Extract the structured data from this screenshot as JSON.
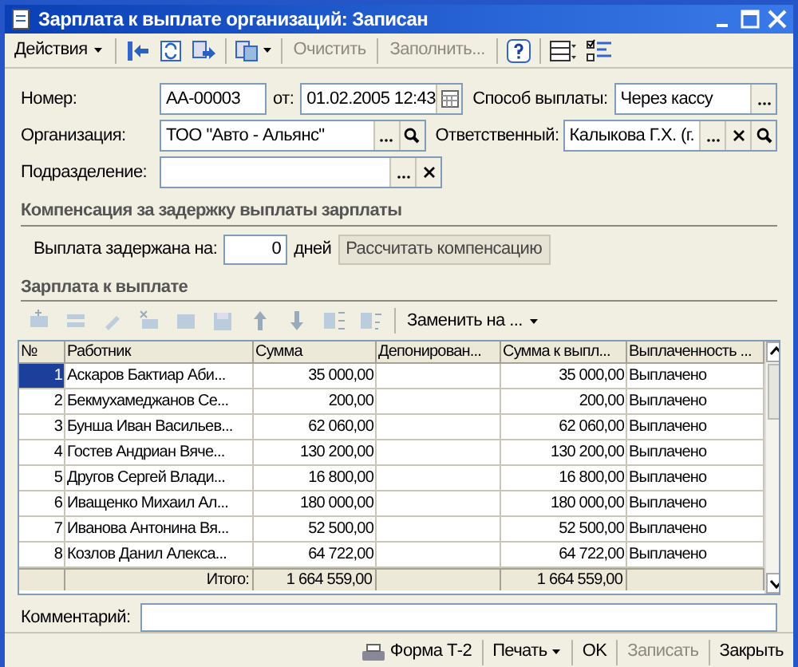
{
  "window": {
    "title": "Зарплата к выплате организаций: Записан"
  },
  "toolbar": {
    "menu": "Действия",
    "buttons": [
      {
        "label": "Очистить",
        "disabled": true
      },
      {
        "label": "Заполнить...",
        "disabled": true
      }
    ]
  },
  "fields": {
    "number": {
      "label": "Номер:",
      "value": "АА-00003"
    },
    "date": {
      "label": "от:",
      "value": "01.02.2005 12:43"
    },
    "payment_method": {
      "label": "Способ выплаты:",
      "value": "Через кассу"
    },
    "organization": {
      "label": "Организация:",
      "value": "ТОО \"Авто - Альянс\""
    },
    "responsible": {
      "label": "Ответственный:",
      "value": "Калыкова Г.Х. (г."
    },
    "department": {
      "label": "Подразделение:"
    }
  },
  "compensation": {
    "title": "Компенсация за задержку выплаты зарплаты",
    "delay_label": "Выплата задержана на:",
    "delay_value": "0",
    "unit": "дней",
    "button": "Рассчитать компенсацию"
  },
  "salary": {
    "title": "Зарплата к выплате",
    "replace_menu": "Заменить на ...",
    "table": {
      "columns": [
        "№",
        "Работник",
        "Сумма",
        "Депонирован...",
        "Сумма к выпл...",
        "Выплаченность ..."
      ],
      "rows": [
        {
          "cells": [
            "1",
            "Аскаров Бактиар Аби...",
            "35 000,00",
            "",
            "35 000,00",
            "Выплачено"
          ],
          "selected": true
        },
        {
          "cells": [
            "2",
            "Бекмухамеджанов Се...",
            "200,00",
            "",
            "200,00",
            "Выплачено"
          ],
          "selected": false
        },
        {
          "cells": [
            "3",
            "Бунша Иван Васильев...",
            "62 060,00",
            "",
            "62 060,00",
            "Выплачено"
          ],
          "selected": false
        },
        {
          "cells": [
            "4",
            "Гостев Андриан Вяче...",
            "130 200,00",
            "",
            "130 200,00",
            "Выплачено"
          ],
          "selected": false
        },
        {
          "cells": [
            "5",
            "Другов Сергей Влади...",
            "16 800,00",
            "",
            "16 800,00",
            "Выплачено"
          ],
          "selected": false
        },
        {
          "cells": [
            "6",
            "Иващенко Михаил Ал...",
            "180 000,00",
            "",
            "180 000,00",
            "Выплачено"
          ],
          "selected": false
        },
        {
          "cells": [
            "7",
            "Иванова Антонина Вя...",
            "52 500,00",
            "",
            "52 500,00",
            "Выплачено"
          ],
          "selected": false
        },
        {
          "cells": [
            "8",
            "Козлов Данил Алекса...",
            "64 722,00",
            "",
            "64 722,00",
            "Выплачено"
          ],
          "selected": false
        }
      ],
      "totals": {
        "label": "Итого:",
        "sum": "1 664 559,00",
        "payable": "1 664 559,00"
      }
    }
  },
  "comment": {
    "label": "Комментарий:"
  },
  "footer": {
    "buttons": [
      {
        "kind": "print_form",
        "label": "Форма Т-2",
        "disabled": false
      },
      {
        "kind": "menu",
        "label": "Печать",
        "disabled": false
      },
      {
        "kind": "button",
        "label": "OK",
        "disabled": false
      },
      {
        "kind": "button",
        "label": "Записать",
        "disabled": true
      },
      {
        "kind": "button",
        "label": "Закрыть",
        "disabled": false
      }
    ]
  }
}
